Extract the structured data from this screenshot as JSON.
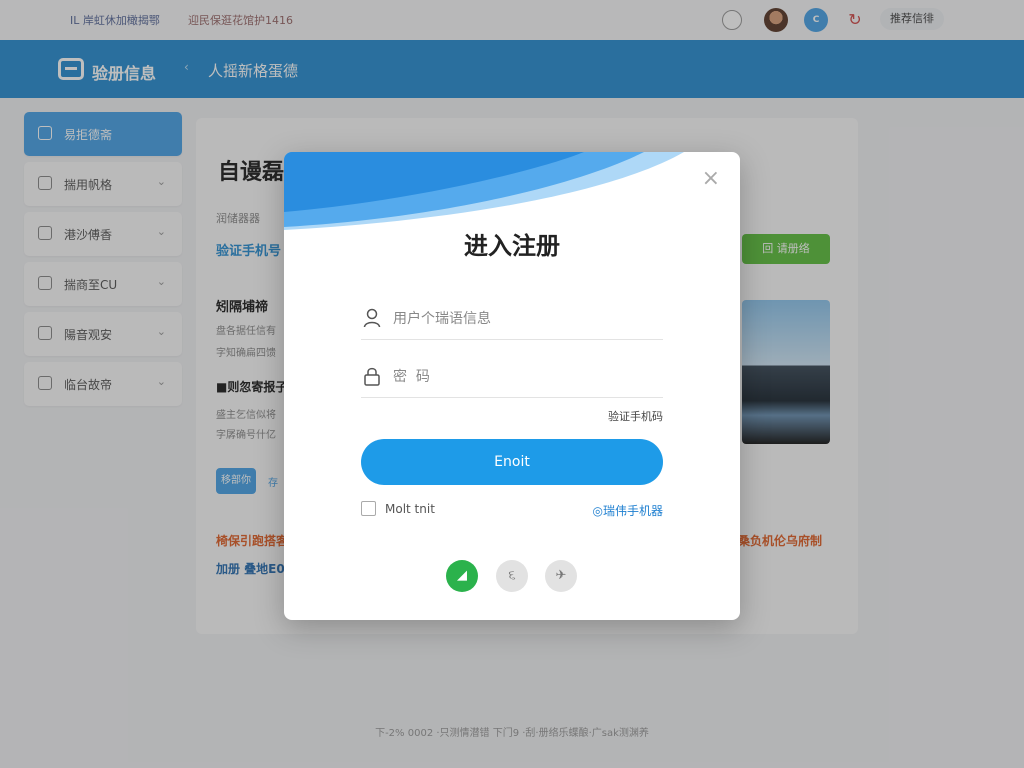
{
  "topbar": {
    "left_text": "IL 岸虹休加橄揭鄂",
    "right_text": "迎民保逛花馆护1416",
    "pill": "推荐信徘",
    "icons": [
      "user-icon",
      "avatar",
      "brand-icon",
      "refresh-icon"
    ]
  },
  "header": {
    "logo_text": "验册信息",
    "breadcrumb_sep": "‹",
    "title": "人摇新格蛋德"
  },
  "sidebar": {
    "items": [
      {
        "label": "易拒德斋",
        "icon": "document-icon",
        "active": true
      },
      {
        "label": "揣用帆格",
        "icon": "chart-icon",
        "active": false
      },
      {
        "label": "港沙傅香",
        "icon": "home-icon",
        "active": false
      },
      {
        "label": "揣商至CU",
        "icon": "lock-icon",
        "active": false
      },
      {
        "label": "陽音观安",
        "icon": "grid-icon",
        "active": false
      },
      {
        "label": "临台故帝",
        "icon": "user-icon",
        "active": false
      }
    ],
    "chevron": "⌄"
  },
  "main": {
    "title": "自谩磊",
    "subtitle": "润储器器",
    "link": "验证手机号",
    "heading2": "矧隔埔禘",
    "para1": "盘各据任信有",
    "para2": "字知确扁四馈",
    "heading3": "■则忽寄报子",
    "para3": "盛主乞信似将",
    "para4": "字孱确号什亿",
    "btn": "移部你",
    "btn2": "存",
    "green_btn": "回 请册络",
    "orange_left": "椅保引跑搭客",
    "orange_right": "桑负机伦乌府制",
    "blue_text": "加册 叠地E0"
  },
  "modal": {
    "title": "进入注册",
    "username_placeholder": "用户个瑞语信息",
    "password_placeholder": "密  码",
    "aux_link": "验证手机码",
    "primary_button": "Enoit",
    "remember_label": "Molt tnit",
    "alt_link": "◎瑞伟手机器",
    "close": "×",
    "social": [
      {
        "icon": "leaf-icon",
        "glyph": "◢",
        "color": "#2bb24c"
      },
      {
        "icon": "swirl-icon",
        "glyph": "૬",
        "color": "#e2e2e2"
      },
      {
        "icon": "pin-icon",
        "glyph": "✈",
        "color": "#e2e2e2"
      }
    ]
  },
  "footer": {
    "text": "下-2% 0002 ·只测情潜错  下门9 ·刮·册络乐蝶酿·广sak测渊养"
  },
  "colors": {
    "header_blue": "#2b8fd1",
    "primary_button": "#1e9be8",
    "accent_green": "#5fbf3f",
    "accent_orange": "#e0622a"
  }
}
